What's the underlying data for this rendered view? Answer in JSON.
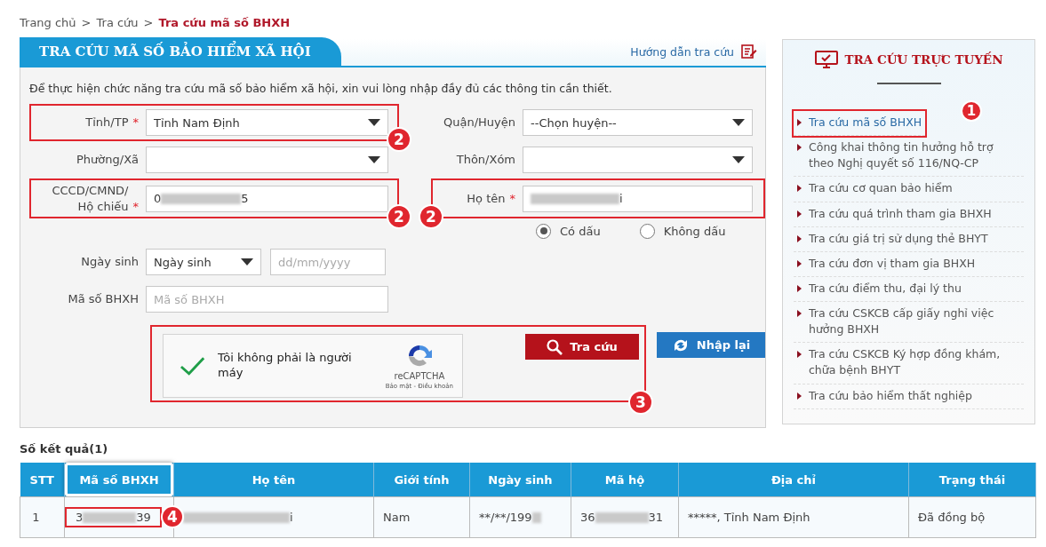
{
  "breadcrumb": {
    "separator": ">",
    "items": [
      {
        "label": "Trang chủ",
        "current": false
      },
      {
        "label": "Tra cứu",
        "current": false
      },
      {
        "label": "Tra cứu mã số BHXH",
        "current": true
      }
    ]
  },
  "panel": {
    "title": "TRA CỨU MÃ SỐ BẢO HIỂM XÃ HỘI",
    "help_link": "Hướng dẫn tra cứu",
    "intro": "Để thực hiện chức năng tra cứu mã số bảo hiểm xã hội, xin vui lòng nhập đầy đủ các thông tin cần thiết.",
    "rows": [
      {
        "left": {
          "kind": "select",
          "label": "Tỉnh/TP",
          "required_mark": "*",
          "value": "Tỉnh Nam Định",
          "badge": "2"
        },
        "right": {
          "kind": "select",
          "label": "Quận/Huyện",
          "value": "--Chọn huyện--"
        }
      },
      {
        "left": {
          "kind": "select",
          "label": "Phường/Xã"
        },
        "right": {
          "kind": "select",
          "label": "Thôn/Xóm"
        }
      },
      {
        "left": {
          "kind": "text",
          "label": "CCCD/CMND/ Hộ chiếu",
          "required_mark": "*",
          "value_start": "0",
          "value_end": "5",
          "redacted": true,
          "badge": "2"
        },
        "right": {
          "kind": "text",
          "label": "Họ tên",
          "required_mark": "*",
          "value_end": "i",
          "redacted": true,
          "badge": "2"
        }
      },
      {
        "right": {
          "kind": "radios",
          "options": [
            {
              "label": "Có dấu",
              "selected": true
            },
            {
              "label": "Không dấu",
              "selected": false
            }
          ]
        }
      },
      {
        "left": {
          "kind": "date",
          "label": "Ngày sinh",
          "value": "Ngày sinh",
          "placeholder": "dd/mm/yyyy"
        }
      },
      {
        "left": {
          "kind": "text",
          "label": "Mã số BHXH",
          "placeholder": "Mã số BHXH"
        }
      }
    ],
    "captcha": {
      "text": "Tôi không phải là người máy",
      "checked": true,
      "brand": "reCAPTCHA",
      "terms": "Bảo mật - Điều khoản"
    },
    "buttons": [
      {
        "label": "Tra cứu",
        "kind": "search"
      },
      {
        "label": "Nhập lại",
        "kind": "reset"
      }
    ],
    "action_badge": "3"
  },
  "sidebar": {
    "title": "TRA CỨU TRỰC TUYẾN",
    "items": [
      {
        "label": "Tra cứu mã số BHXH",
        "selected": true,
        "badge": "1"
      },
      {
        "label": "Công khai thông tin hưởng hỗ trợ theo Nghị quyết số 116/NQ-CP",
        "selected": false
      },
      {
        "label": "Tra cứu cơ quan bảo hiểm",
        "selected": false
      },
      {
        "label": "Tra cứu quá trình tham gia BHXH",
        "selected": false
      },
      {
        "label": "Tra cứu giá trị sử dụng thẻ BHYT",
        "selected": false
      },
      {
        "label": "Tra cứu đơn vị tham gia BHXH",
        "selected": false
      },
      {
        "label": "Tra cứu điểm thu, đại lý thu",
        "selected": false
      },
      {
        "label": "Tra cứu CSKCB cấp giấy nghỉ việc hưởng BHXH",
        "selected": false
      },
      {
        "label": "Tra cứu CSKCB Ký hợp đồng khám, chữa bệnh BHYT",
        "selected": false
      },
      {
        "label": "Tra cứu bảo hiểm thất nghiệp",
        "selected": false
      }
    ]
  },
  "results": {
    "count_label": "Số kết quả(1)",
    "columns": [
      {
        "label": "STT",
        "highlighted": false
      },
      {
        "label": "Mã số BHXH",
        "highlighted": true
      },
      {
        "label": "Họ tên",
        "highlighted": false
      },
      {
        "label": "Giới tính",
        "highlighted": false
      },
      {
        "label": "Ngày sinh",
        "highlighted": false
      },
      {
        "label": "Mã hộ",
        "highlighted": false
      },
      {
        "label": "Địa chỉ",
        "highlighted": false
      },
      {
        "label": "Trạng thái",
        "highlighted": false
      }
    ],
    "rows": [
      {
        "cells": [
          {
            "start": "1"
          },
          {
            "start": "3",
            "end": "39",
            "redacted": true,
            "badge": "4"
          },
          {
            "end": "i",
            "redacted": true
          },
          {
            "start": "Nam"
          },
          {
            "start": "**/**/199",
            "redacted": true
          },
          {
            "start": "36",
            "end": "31",
            "redacted": true
          },
          {
            "start": "*****, Tỉnh Nam Định"
          },
          {
            "start": "Đã đồng bộ"
          }
        ]
      }
    ]
  }
}
